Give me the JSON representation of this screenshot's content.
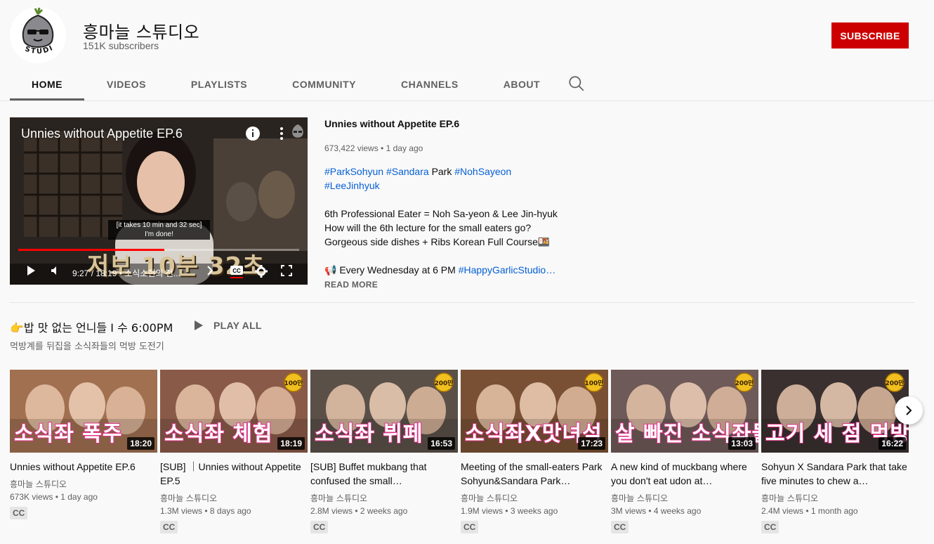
{
  "channel": {
    "name": "흥마늘 스튜디오",
    "subscribers": "151K subscribers",
    "subscribe_label": "SUBSCRIBE",
    "logo_text": "STUDIO"
  },
  "tabs": [
    {
      "label": "HOME",
      "active": true
    },
    {
      "label": "VIDEOS"
    },
    {
      "label": "PLAYLISTS"
    },
    {
      "label": "COMMUNITY"
    },
    {
      "label": "CHANNELS"
    },
    {
      "label": "ABOUT"
    }
  ],
  "featured": {
    "player_title": "Unnies without Appetite EP.6",
    "caption_line1": "[it takes 10 min and 32 sec]",
    "caption_line2": "I'm done!",
    "overlay_text": "저보 10분 32초",
    "time": "9:27 / 18:19",
    "chapter": "• 소식소현의 전...",
    "progress": 0.52,
    "title": "Unnies without Appetite EP.6",
    "meta": "673,422 views • 1 day ago",
    "tags": [
      "#ParkSohyun",
      "#Sandara",
      "#NohSayeon",
      "#LeeJinhyuk"
    ],
    "tag_plain": "Park",
    "desc_line1": "6th Professional Eater = Noh Sa-yeon & Lee Jin-hyuk",
    "desc_line2": "How will the 6th lecture for the small eaters go?",
    "desc_line3": "Gorgeous side dishes + Ribs Korean Full Course🍱",
    "desc_line4_prefix": "📢 Every Wednesday at 6 PM",
    "desc_line4_tag": "#HappyGarlicStudio…",
    "read_more": "READ MORE"
  },
  "shelf": {
    "title": "👉밥 맛 없는 언니들 I 수 6:00PM",
    "play_all": "PLAY ALL",
    "subtitle": "먹방계를 뒤집을 소식좌들의 먹방 도전기",
    "videos": [
      {
        "thumb_text": "소식좌 폭주",
        "duration": "18:20",
        "title": "Unnies without Appetite EP.6",
        "channel": "흥마늘 스튜디오",
        "meta": "673K views • 1 day ago",
        "cc": "CC",
        "bg": "#a07050"
      },
      {
        "thumb_text": "소식좌 체험",
        "duration": "18:19",
        "title": "[SUB] ｜Unnies without Appetite EP.5",
        "channel": "흥마늘 스튜디오",
        "meta": "1.3M views • 8 days ago",
        "cc": "CC",
        "bg": "#8a5a48",
        "badge": "100만"
      },
      {
        "thumb_text": "소식좌 뷔페",
        "duration": "16:53",
        "title": "[SUB] Buffet mukbang that confused the small…",
        "channel": "흥마늘 스튜디오",
        "meta": "2.8M views • 2 weeks ago",
        "cc": "CC",
        "bg": "#5a5048",
        "badge": "200만"
      },
      {
        "thumb_text": "소식좌X맛녀석",
        "duration": "17:23",
        "title": "Meeting of the small-eaters Park Sohyun&Sandara Park…",
        "channel": "흥마늘 스튜디오",
        "meta": "1.9M views • 3 weeks ago",
        "cc": "CC",
        "bg": "#7a5034",
        "badge": "100만"
      },
      {
        "thumb_text": "살 빠진 소식좌들",
        "duration": "13:03",
        "title": "A new kind of muckbang where you don't eat udon at…",
        "channel": "흥마늘 스튜디오",
        "meta": "3M views • 4 weeks ago",
        "cc": "CC",
        "bg": "#6e5a58",
        "badge": "200만"
      },
      {
        "thumb_text": "고기 세 점 먹방",
        "duration": "16:22",
        "title": "Sohyun X Sandara Park that take five minutes to chew a…",
        "channel": "흥마늘 스튜디오",
        "meta": "2.4M views • 1 month ago",
        "cc": "CC",
        "bg": "#3a3030",
        "badge": "200만"
      }
    ]
  },
  "colors": {
    "subscribe": "#cc0000",
    "link": "#065fd4",
    "progress": "#ff0000"
  }
}
